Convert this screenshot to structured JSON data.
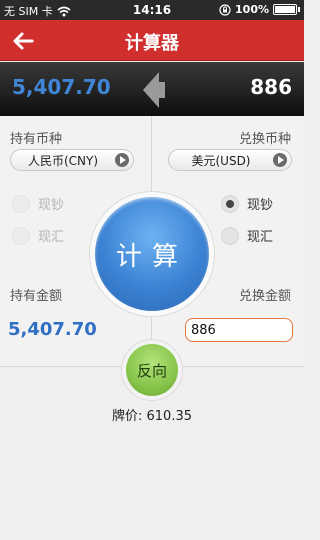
{
  "status_bar": {
    "carrier": "无 SIM 卡",
    "wifi_icon": "wifi-icon",
    "time": "14:16",
    "lock_icon": "rotation-lock-icon",
    "battery": "100%"
  },
  "nav": {
    "back_icon": "back-arrow-icon",
    "title": "计算器"
  },
  "result": {
    "from_amount": "5,407.70",
    "to_amount": "886",
    "arrow_icon": "left-arrow-icon"
  },
  "from": {
    "label": "持有币种",
    "currency": "人民币(CNY)",
    "options": [
      {
        "label": "现钞",
        "selected": false,
        "enabled": false
      },
      {
        "label": "现汇",
        "selected": false,
        "enabled": false
      }
    ],
    "amount_label": "持有金额",
    "amount": "5,407.70"
  },
  "to": {
    "label": "兑换币种",
    "currency": "美元(USD)",
    "options": [
      {
        "label": "现钞",
        "selected": true,
        "enabled": true
      },
      {
        "label": "现汇",
        "selected": false,
        "enabled": true
      }
    ],
    "amount_label": "兑换金额",
    "amount": "886"
  },
  "actions": {
    "calculate": "计算",
    "reverse": "反向"
  },
  "rate_text": "牌价: 610.35",
  "colors": {
    "nav_red": "#d12e2e",
    "accent_blue": "#3b82d4",
    "reverse_green": "#86c44a",
    "input_border_orange": "#e2773d"
  }
}
